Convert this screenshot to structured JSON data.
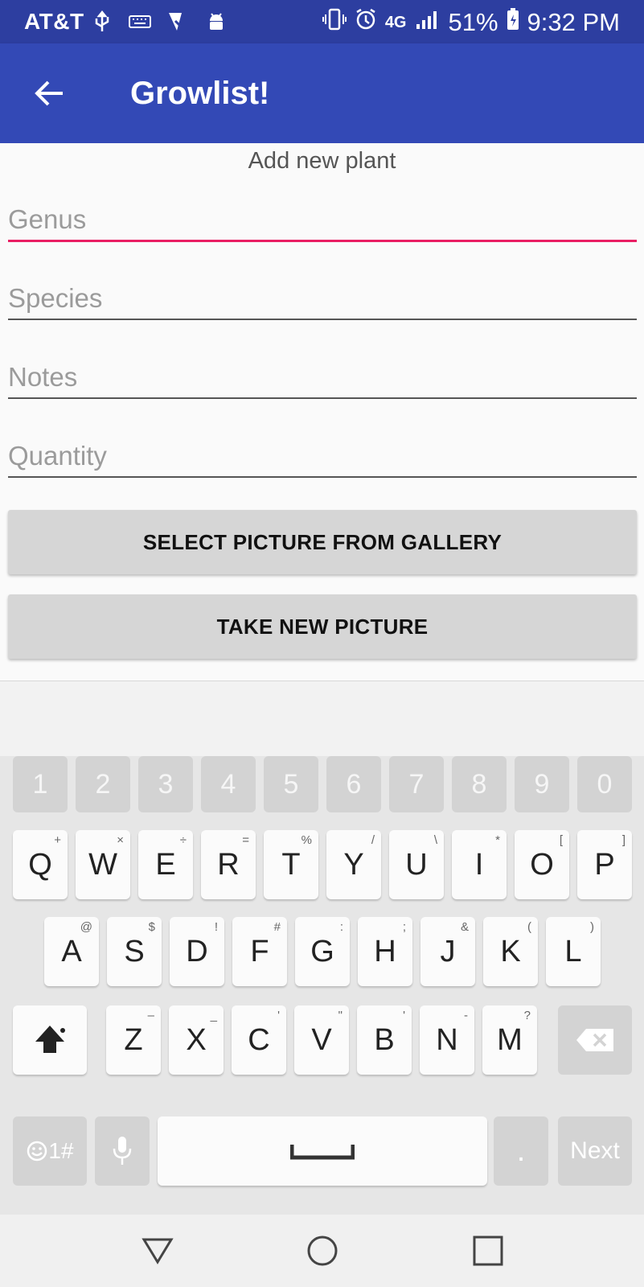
{
  "status": {
    "carrier": "AT&T",
    "network": "4G",
    "battery": "51%",
    "time": "9:32 PM"
  },
  "appbar": {
    "title": "Growlist!"
  },
  "form": {
    "subtitle": "Add new plant",
    "genus_placeholder": "Genus",
    "species_placeholder": "Species",
    "notes_placeholder": "Notes",
    "quantity_placeholder": "Quantity",
    "gallery_button": "SELECT PICTURE FROM GALLERY",
    "camera_button": "TAKE NEW PICTURE"
  },
  "keyboard": {
    "numbers": [
      "1",
      "2",
      "3",
      "4",
      "5",
      "6",
      "7",
      "8",
      "9",
      "0"
    ],
    "row1": [
      {
        "k": "Q",
        "a": "+"
      },
      {
        "k": "W",
        "a": "×"
      },
      {
        "k": "E",
        "a": "÷"
      },
      {
        "k": "R",
        "a": "="
      },
      {
        "k": "T",
        "a": "%"
      },
      {
        "k": "Y",
        "a": "/"
      },
      {
        "k": "U",
        "a": "\\"
      },
      {
        "k": "I",
        "a": "*"
      },
      {
        "k": "O",
        "a": "["
      },
      {
        "k": "P",
        "a": "]"
      }
    ],
    "row2": [
      {
        "k": "A",
        "a": "@"
      },
      {
        "k": "S",
        "a": "$"
      },
      {
        "k": "D",
        "a": "!"
      },
      {
        "k": "F",
        "a": "#"
      },
      {
        "k": "G",
        "a": ":"
      },
      {
        "k": "H",
        "a": ";"
      },
      {
        "k": "J",
        "a": "&"
      },
      {
        "k": "K",
        "a": "("
      },
      {
        "k": "L",
        "a": ")"
      }
    ],
    "row3": [
      {
        "k": "Z",
        "a": "–"
      },
      {
        "k": "X",
        "a": "_"
      },
      {
        "k": "C",
        "a": "'"
      },
      {
        "k": "V",
        "a": "\""
      },
      {
        "k": "B",
        "a": "'"
      },
      {
        "k": "N",
        "a": "-"
      },
      {
        "k": "M",
        "a": "?"
      }
    ],
    "symbols_label": "1#",
    "period_label": ".",
    "next_label": "Next"
  },
  "icons": {
    "back": "arrow-left-icon",
    "shift": "shift-icon",
    "backspace": "backspace-icon",
    "mic": "mic-icon",
    "emoji": "emoji-icon",
    "space": "space-bar-icon"
  },
  "colors": {
    "statusbar": "#2d3ea0",
    "appbar": "#3349b6",
    "accent": "#e91e63"
  }
}
